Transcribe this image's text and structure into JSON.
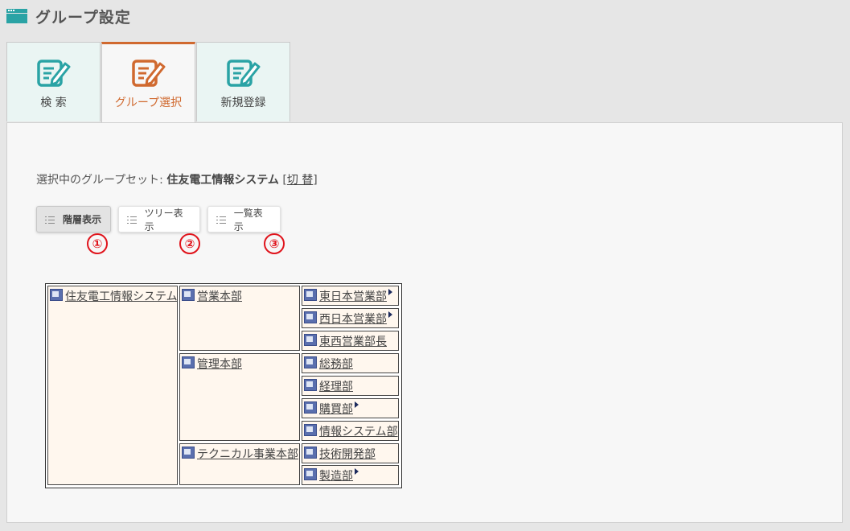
{
  "header": {
    "title": "グループ設定"
  },
  "tabs": [
    {
      "label": "検 索",
      "active": false
    },
    {
      "label": "グループ選択",
      "active": true
    },
    {
      "label": "新規登録",
      "active": false
    }
  ],
  "set_line": {
    "prefix": "選択中のグループセット: ",
    "name": "住友電工情報システム",
    "open_bracket": " [",
    "switch_label": "切 替",
    "close_bracket": "]"
  },
  "view_buttons": [
    {
      "label": "階層表示",
      "active": true,
      "marker": "①"
    },
    {
      "label": "ツリー表示",
      "active": false,
      "marker": "②"
    },
    {
      "label": "一覧表示",
      "active": false,
      "marker": "③"
    }
  ],
  "hierarchy": {
    "root": "住友電工情報システム",
    "divisions": [
      {
        "name": "営業本部",
        "departments": [
          {
            "name": "東日本営業部",
            "has_children": true
          },
          {
            "name": "西日本営業部",
            "has_children": true
          },
          {
            "name": "東西営業部長",
            "has_children": false
          }
        ]
      },
      {
        "name": "管理本部",
        "departments": [
          {
            "name": "総務部",
            "has_children": false
          },
          {
            "name": "経理部",
            "has_children": false
          },
          {
            "name": "購買部",
            "has_children": true
          },
          {
            "name": "情報システム部",
            "has_children": false
          }
        ]
      },
      {
        "name": "テクニカル事業本部",
        "departments": [
          {
            "name": "技術開発部",
            "has_children": false
          },
          {
            "name": "製造部",
            "has_children": true
          }
        ]
      }
    ]
  },
  "colors": {
    "accent": "#d0692f",
    "teal": "#2aa3a5",
    "marker": "#e0141c",
    "cell_bg": "#fff7ee"
  }
}
